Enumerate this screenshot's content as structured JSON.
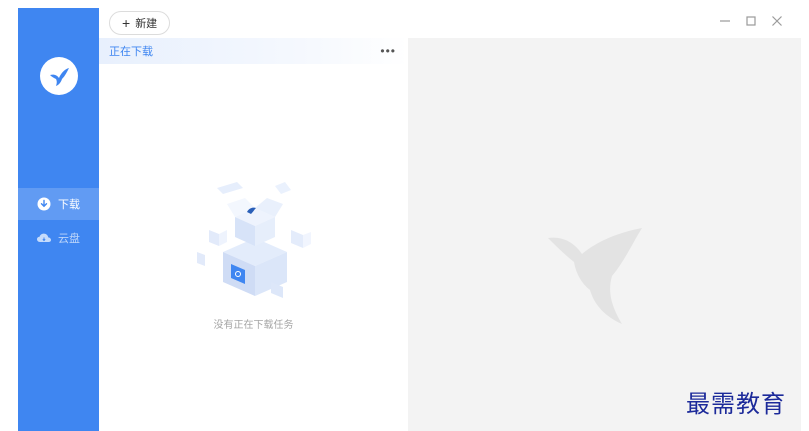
{
  "sidebar": {
    "items": [
      {
        "label": "下载",
        "icon": "download-icon",
        "active": true
      },
      {
        "label": "云盘",
        "icon": "cloud-icon",
        "active": false
      }
    ]
  },
  "titlebar": {
    "new_button_label": "新建"
  },
  "list": {
    "title": "正在下载",
    "more_label": "•••",
    "empty_text": "没有正在下载任务"
  },
  "watermark": {
    "text": "最需教育"
  },
  "colors": {
    "sidebar": "#3f86f1",
    "accent": "#3f86f1",
    "detail_bg": "#f3f3f3"
  }
}
